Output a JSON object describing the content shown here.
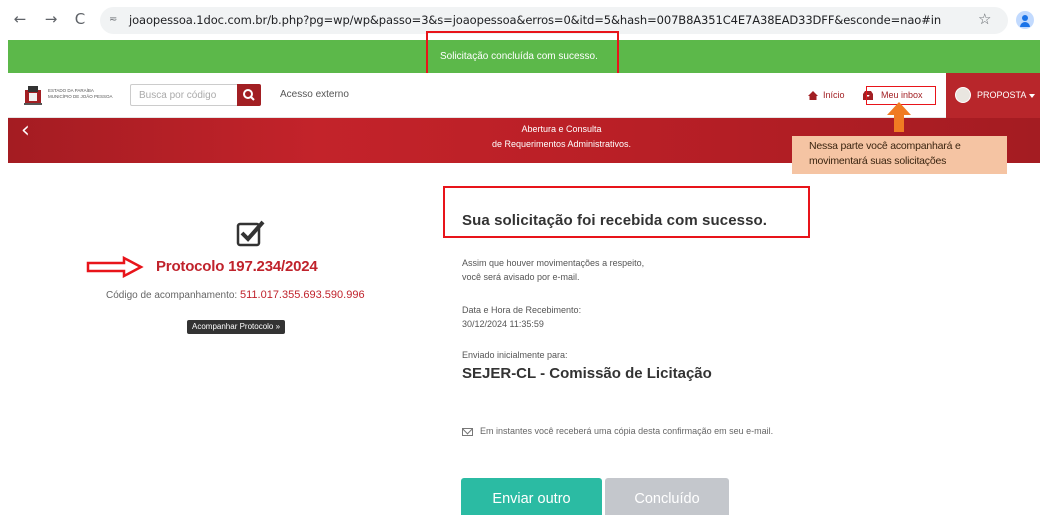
{
  "browser": {
    "back": "←",
    "forward": "→",
    "reload": "C",
    "site_icon": "≂",
    "url": "joaopessoa.1doc.com.br/b.php?pg=wp/wp&passo=3&s=joaopessoa&erros=0&itd=5&hash=007B8A351C4E7A38EAD33DFF&esconde=nao#in",
    "star": "☆"
  },
  "banner": {
    "message": "Solicitação concluída com sucesso."
  },
  "header": {
    "logo_text_line1": "ESTADO DA PARAÍBA",
    "logo_text_line2": "MUNICÍPIO DE JOÃO PESSOA",
    "search_placeholder": "Busca por código",
    "external_access": "Acesso externo",
    "home": "Início",
    "inbox": "Meu inbox",
    "proposta": "PROPOSTA"
  },
  "hero": {
    "line1": "Abertura e Consulta",
    "line2": "de Requerimentos Administrativos."
  },
  "callout": {
    "line1": "Nessa parte você acompanhará e",
    "line2": "movimentará suas solicitações"
  },
  "confirmation": {
    "protocol": "Protocolo 197.234/2024",
    "tracking_label": "Código de acompanhamento:",
    "tracking_code": "511.017.355.693.590.996",
    "track_button": "Acompanhar Protocolo »",
    "title": "Sua solicitação foi recebida com sucesso.",
    "notice_line1": "Assim que houver movimentações a respeito,",
    "notice_line2": "você será avisado por e-mail.",
    "received_label": "Data e Hora de Recebimento:",
    "received_value": "30/12/2024 11:35:59",
    "sent_label": "Enviado inicialmente para:",
    "sent_value": "SEJER-CL - Comissão de Licitação",
    "email_notice": "Em instantes você receberá uma cópia desta confirmação em seu e-mail.",
    "send_another": "Enviar outro",
    "done": "Concluído"
  },
  "colors": {
    "success_green": "#5cb84a",
    "brand_red": "#b8262b",
    "annotation_red": "#e8141a",
    "teal_button": "#2bbba3",
    "callout_bg": "#f5c4a3",
    "arrow_orange": "#f07b22"
  }
}
